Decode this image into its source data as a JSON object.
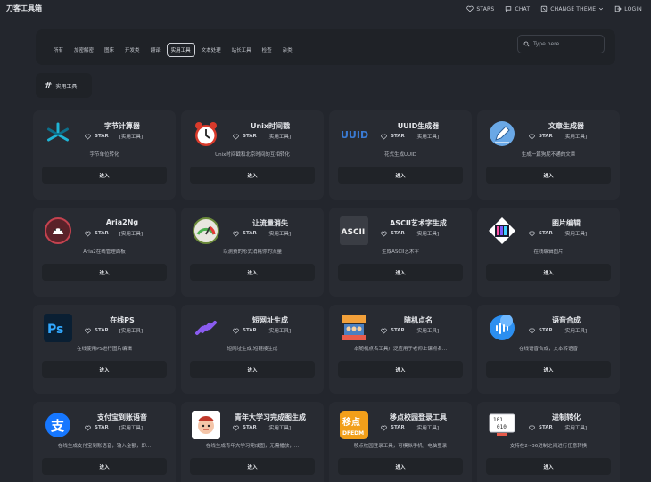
{
  "app": {
    "brand": "刀客工具箱"
  },
  "topnav": [
    {
      "label": "STARS",
      "icon": "heart-icon"
    },
    {
      "label": "CHAT",
      "icon": "chat-icon"
    },
    {
      "label": "CHANGE THEME",
      "icon": "theme-icon"
    },
    {
      "label": "LOGIN",
      "icon": "login-icon"
    }
  ],
  "categories": [
    "所有",
    "加密解密",
    "图床",
    "开发类",
    "翻译",
    "实用工具",
    "文本处理",
    "站长工具",
    "检查",
    "杂类"
  ],
  "active_category": "实用工具",
  "search": {
    "placeholder": "Type here"
  },
  "section": {
    "hash": "#",
    "label": "实用工具"
  },
  "card_common": {
    "star": "STAR",
    "tag": "[实用工具]",
    "enter": "进入"
  },
  "cards": [
    {
      "title": "字节计算器",
      "desc": "字节单位转化",
      "icon": "byte-calculator-icon"
    },
    {
      "title": "Unix时间戳",
      "desc": "Unix时间戳和北京时间的互相转化",
      "icon": "alarm-clock-icon"
    },
    {
      "title": "UUID生成器",
      "desc": "花式生成UUID",
      "icon": "uuid-icon"
    },
    {
      "title": "文章生成器",
      "desc": "生成一篇狗屁不通的文章",
      "icon": "pen-icon"
    },
    {
      "title": "Aria2Ng",
      "desc": "Aria2在线管理面板",
      "icon": "aria2-icon"
    },
    {
      "title": "让流量消失",
      "desc": "以测费的形式消耗你的流量",
      "icon": "gauge-icon"
    },
    {
      "title": "ASCII艺术字生成",
      "desc": "生成ASCII艺术字",
      "icon": "ascii-icon"
    },
    {
      "title": "图片编辑",
      "desc": "在线编辑图片",
      "icon": "image-editor-icon"
    },
    {
      "title": "在线PS",
      "desc": "在线使用PS进行图片编辑",
      "icon": "photoshop-icon"
    },
    {
      "title": "短网址生成",
      "desc": "短网址生成,短链接生成",
      "icon": "link-icon"
    },
    {
      "title": "随机点名",
      "desc": "本随机点名工具广泛应用于老师上课点名...",
      "icon": "random-call-icon"
    },
    {
      "title": "语音合成",
      "desc": "在线语音合成，文本转语音",
      "icon": "voice-icon"
    },
    {
      "title": "支付宝到账语音",
      "desc": "在线生成支付宝到账语音，输入金额，即...",
      "icon": "alipay-icon"
    },
    {
      "title": "青年大学习完成图生成",
      "desc": "在线生成青年大学习完成图，无需播放，...",
      "icon": "youth-study-icon"
    },
    {
      "title": "移点校园登录工具",
      "desc": "移点校园登录工具，可模拟手机，电脑登录",
      "icon": "yidian-icon"
    },
    {
      "title": "进制转化",
      "desc": "支持在2~36进制之间进行任意转换",
      "icon": "binary-icon"
    }
  ]
}
